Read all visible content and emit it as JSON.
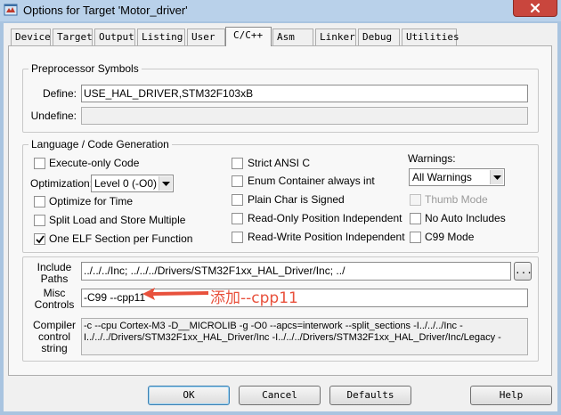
{
  "window": {
    "title": "Options for Target 'Motor_driver'",
    "close_glyph": "✕"
  },
  "tabs": [
    {
      "label": "Device",
      "active": false
    },
    {
      "label": "Target",
      "active": false
    },
    {
      "label": "Output",
      "active": false
    },
    {
      "label": "Listing",
      "active": false
    },
    {
      "label": "User",
      "active": false
    },
    {
      "label": "C/C++",
      "active": true
    },
    {
      "label": "Asm",
      "active": false
    },
    {
      "label": "Linker",
      "active": false
    },
    {
      "label": "Debug",
      "active": false
    },
    {
      "label": "Utilities",
      "active": false
    }
  ],
  "preprocessor": {
    "group_title": "Preprocessor Symbols",
    "define_label": "Define:",
    "define_value": "USE_HAL_DRIVER,STM32F103xB",
    "undefine_label": "Undefine:",
    "undefine_value": ""
  },
  "language": {
    "group_title": "Language / Code Generation",
    "execute_only": {
      "label": "Execute-only Code",
      "checked": false
    },
    "optimization_label": "Optimization:",
    "optimization_value": "Level 0 (-O0)",
    "optimize_time": {
      "label": "Optimize for Time",
      "checked": false
    },
    "split_load": {
      "label": "Split Load and Store Multiple",
      "checked": false
    },
    "one_elf": {
      "label": "One ELF Section per Function",
      "checked": true
    },
    "strict_ansi": {
      "label": "Strict ANSI C",
      "checked": false
    },
    "enum_container": {
      "label": "Enum Container always int",
      "checked": false
    },
    "plain_char": {
      "label": "Plain Char is Signed",
      "checked": false
    },
    "ro_pi": {
      "label": "Read-Only Position Independent",
      "checked": false
    },
    "rw_pi": {
      "label": "Read-Write Position Independent",
      "checked": false
    },
    "warnings_label": "Warnings:",
    "warnings_value": "All Warnings",
    "thumb_mode": {
      "label": "Thumb Mode",
      "checked": false,
      "disabled": true
    },
    "no_auto_includes": {
      "label": "No Auto Includes",
      "checked": false
    },
    "c99_mode": {
      "label": "C99 Mode",
      "checked": false
    }
  },
  "paths": {
    "include_label_1": "Include",
    "include_label_2": "Paths",
    "include_value": "../../../Inc;                              ../../../Drivers/STM32F1xx_HAL_Driver/Inc;                  ../",
    "browse_label": "...",
    "misc_label_1": "Misc",
    "misc_label_2": "Controls",
    "misc_value": "-C99 --cpp11",
    "compiler_label_1": "Compiler",
    "compiler_label_2": "control",
    "compiler_label_3": "string",
    "compiler_value": "-c --cpu Cortex-M3 -D__MICROLIB -g -O0 --apcs=interwork --split_sections -I../../../Inc -\nI../../../Drivers/STM32F1xx_HAL_Driver/Inc -I../../../Drivers/STM32F1xx_HAL_Driver/Inc/Legacy -"
  },
  "annotation": {
    "text": "添加--cpp11",
    "color": "#e8513c"
  },
  "buttons": {
    "ok": "OK",
    "cancel": "Cancel",
    "defaults": "Defaults",
    "help": "Help"
  },
  "icons": {
    "app": "options-app-icon",
    "close": "close-icon",
    "combo": "chevron-down-icon",
    "check": "checkmark-icon"
  }
}
